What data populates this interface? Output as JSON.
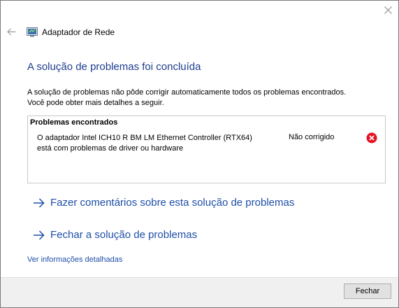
{
  "window": {
    "header_title": "Adaptador de Rede"
  },
  "main": {
    "title": "A solução de problemas foi concluída",
    "description_line1": "A solução de problemas não pôde corrigir automaticamente todos os problemas encontrados.",
    "description_line2": "Você pode obter mais detalhes a seguir."
  },
  "problems": {
    "heading": "Problemas encontrados",
    "items": [
      {
        "description_line1": "O adaptador Intel ICH10 R BM LM Ethernet Controller (RTX64)",
        "description_line2": "está com problemas de driver ou hardware",
        "status": "Não corrigido",
        "status_icon": "error-icon"
      }
    ]
  },
  "links": {
    "feedback": "Fazer comentários sobre esta solução de problemas",
    "close_troubleshooter": "Fechar a solução de problemas",
    "details": "Ver informações detalhadas"
  },
  "footer": {
    "close_button": "Fechar"
  },
  "colors": {
    "title": "#1e3d8f",
    "link": "#1e4fa8",
    "error": "#e81123"
  }
}
